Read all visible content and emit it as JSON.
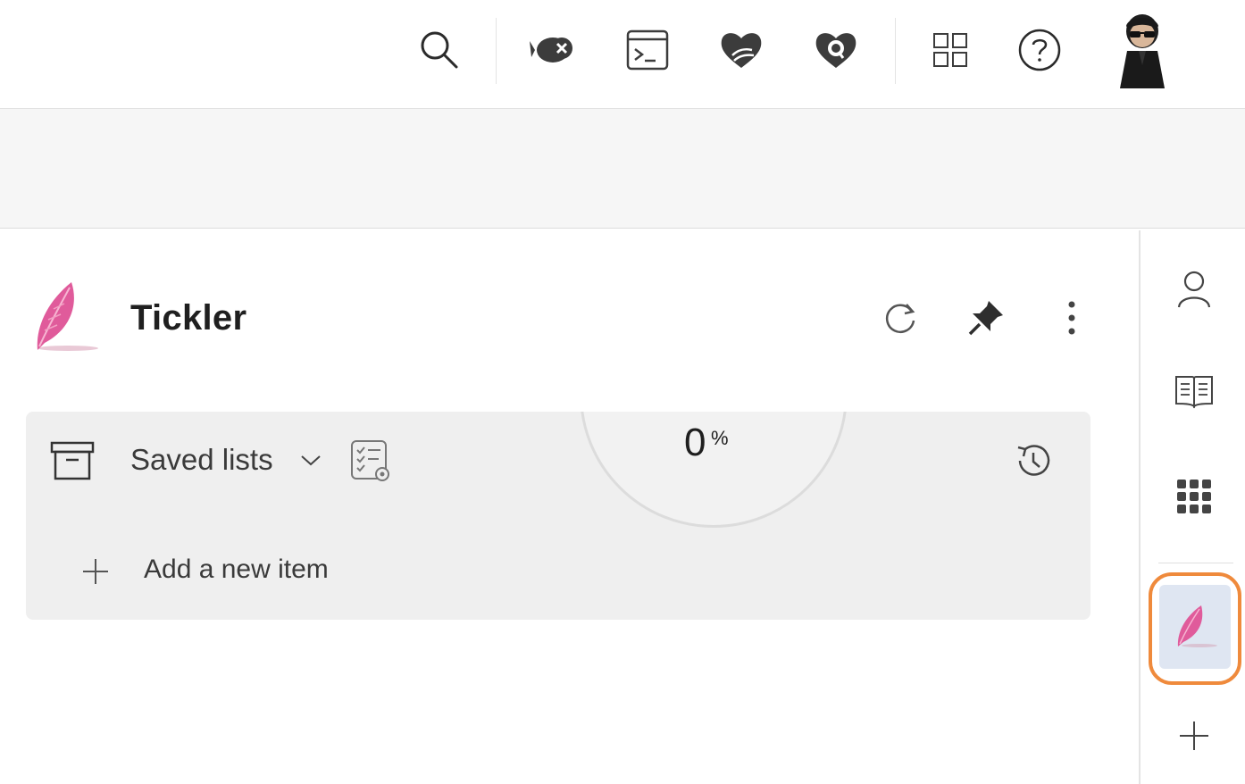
{
  "topbar": {
    "icons": [
      "search-icon",
      "fish-close-icon",
      "terminal-icon",
      "heart-hands-icon",
      "heart-q-icon",
      "apps-grid-icon",
      "help-icon",
      "avatar"
    ]
  },
  "widget": {
    "title": "Tickler",
    "logo": "feather-icon"
  },
  "card": {
    "saved_lists_label": "Saved lists",
    "add_item_label": "Add a new item",
    "progress_value": "0",
    "progress_unit": "%"
  },
  "rail": {
    "items": [
      "person-icon",
      "book-icon",
      "grid-dots-icon",
      "feather-icon",
      "plus-icon"
    ],
    "active_item": "feather-icon"
  },
  "colors": {
    "accent": "#ef8a3c",
    "feather": "#e05b9b",
    "active_bg": "#dfe6f2",
    "card_bg": "#efefef",
    "band_bg": "#f6f6f6"
  }
}
